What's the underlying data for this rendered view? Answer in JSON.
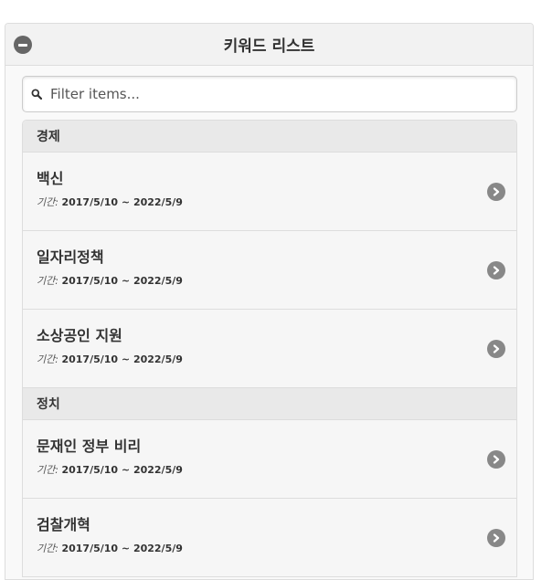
{
  "header": {
    "title": "키워드 리스트",
    "collapse_icon": "minus-circle-icon"
  },
  "filter": {
    "placeholder": "Filter items...",
    "value": "",
    "icon": "search-icon"
  },
  "groups": [
    {
      "label": "경제",
      "items": [
        {
          "title": "백신",
          "period_label": "기간:",
          "period_value": "2017/5/10 ~ 2022/5/9"
        },
        {
          "title": "일자리정책",
          "period_label": "기간:",
          "period_value": "2017/5/10 ~ 2022/5/9"
        },
        {
          "title": "소상공인 지원",
          "period_label": "기간:",
          "period_value": "2017/5/10 ~ 2022/5/9"
        }
      ]
    },
    {
      "label": "정치",
      "items": [
        {
          "title": "문재인 정부 비리",
          "period_label": "기간:",
          "period_value": "2017/5/10 ~ 2022/5/9"
        },
        {
          "title": "검찰개혁",
          "period_label": "기간:",
          "period_value": "2017/5/10 ~ 2022/5/9"
        }
      ]
    }
  ],
  "item_icon": "chevron-right-circle-icon",
  "colors": {
    "header_bg": "#f2f2f2",
    "divider_bg": "#e9e9e9",
    "item_bg": "#f6f6f6",
    "icon_bg": "#888888"
  }
}
